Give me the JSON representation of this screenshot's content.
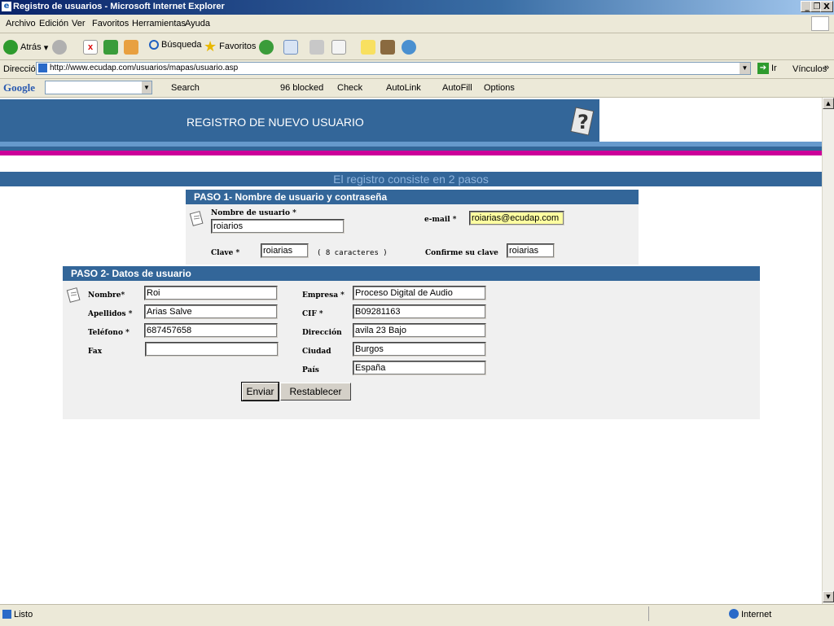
{
  "window": {
    "title": "Registro de usuarios - Microsoft Internet Explorer",
    "min": "_",
    "max": "❐",
    "close": "X"
  },
  "menu": [
    "Archivo",
    "Edición",
    "Ver",
    "Favoritos",
    "Herramientas",
    "Ayuda"
  ],
  "toolbar": {
    "back": "Atrás",
    "search": "Búsqueda",
    "favorites": "Favoritos"
  },
  "address": {
    "label": "Dirección",
    "url": "http://www.ecudap.com/usuarios/mapas/usuario.asp",
    "go": "Ir",
    "links": "Vínculos"
  },
  "google": {
    "logo": "Google",
    "search": "Search",
    "blocked": "96 blocked",
    "check": "Check",
    "autolink": "AutoLink",
    "autofill": "AutoFill",
    "options": "Options"
  },
  "page": {
    "banner_title": "REGISTRO DE NUEVO USUARIO",
    "steps_text": "El registro consiste en 2 pasos",
    "step1": {
      "header": "PASO 1- Nombre de usuario y contraseña",
      "username_label": "Nombre de usuario *",
      "username_value": "roiarios",
      "email_label": "e-mail *",
      "email_value": "roiarias@ecudap.com",
      "password_label": "Clave *",
      "password_value": "roiarias",
      "password_note": "( 8 caracteres )",
      "confirm_label": "Confirme su clave",
      "confirm_value": "roiarias"
    },
    "step2": {
      "header": "PASO 2- Datos de usuario",
      "nombre_label": "Nombre*",
      "nombre_value": "Roi",
      "apellidos_label": "Apellidos *",
      "apellidos_value": "Arias Salve",
      "telefono_label": "Teléfono *",
      "telefono_value": "687457658",
      "fax_label": "Fax",
      "fax_value": "",
      "empresa_label": "Empresa *",
      "empresa_value": "Proceso Digital de Audio",
      "cif_label": "CIF *",
      "cif_value": "B09281163",
      "direccion_label": "Dirección",
      "direccion_value": "avila 23 Bajo",
      "ciudad_label": "Ciudad",
      "ciudad_value": "Burgos",
      "pais_label": "País",
      "pais_value": "España",
      "submit": "Enviar",
      "reset": "Restablecer"
    }
  },
  "status": {
    "text": "Listo",
    "zone": "Internet"
  },
  "colors": {
    "banner": "#336699",
    "stripe_magenta": "#cc0099",
    "stripe_blue": "#6699cc"
  }
}
